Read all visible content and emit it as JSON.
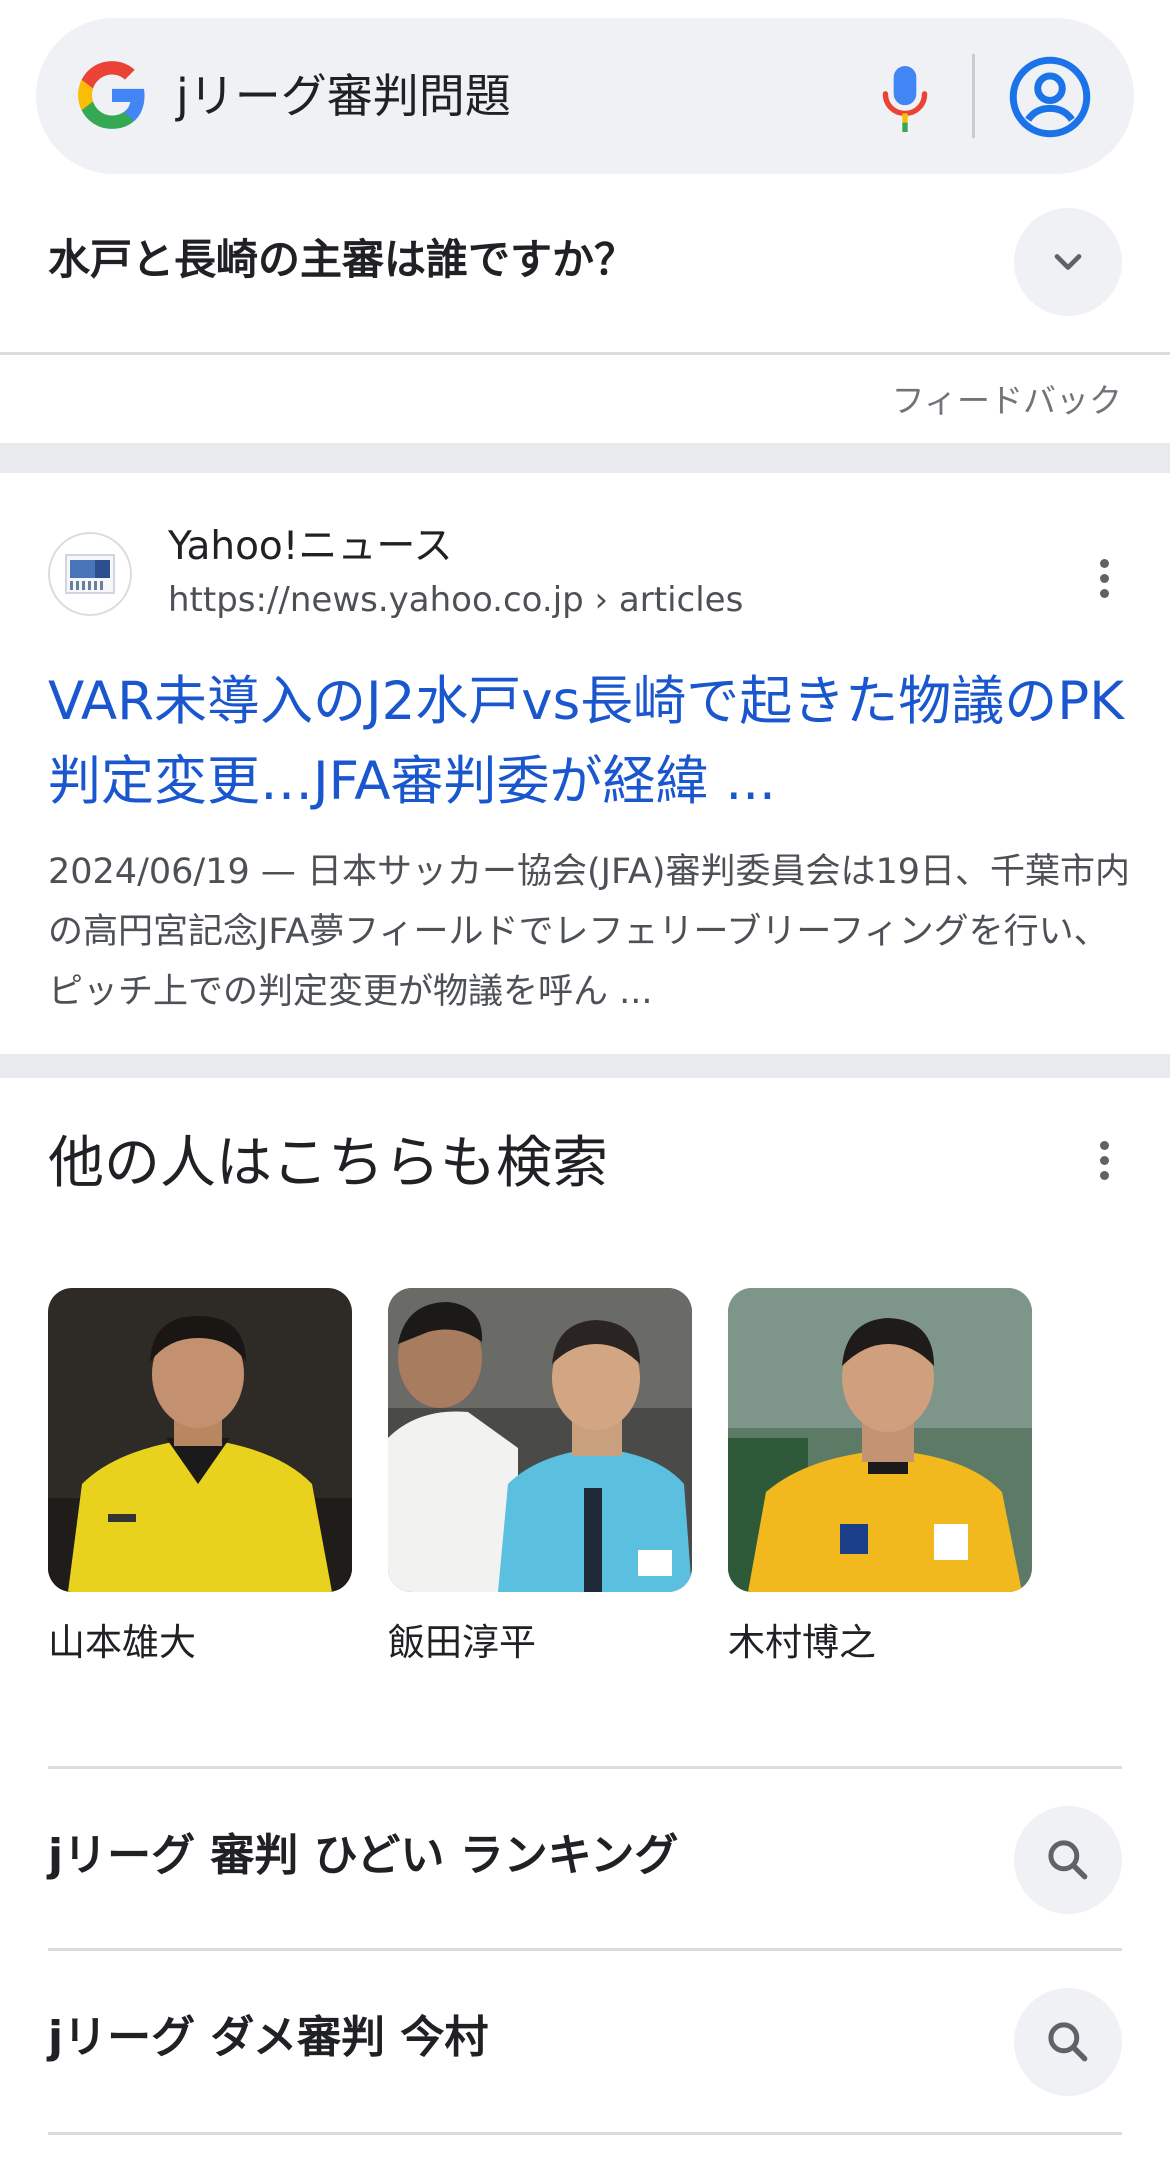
{
  "search": {
    "query": "jリーグ審判問題",
    "icons": {
      "logo": "google-g-logo",
      "mic": "mic-icon",
      "account": "account-circle-icon"
    }
  },
  "people_also_ask": {
    "question": "水戸と長崎の主審は誰ですか？",
    "expand_icon": "chevron-down-icon",
    "feedback_label": "フィードバック"
  },
  "result": {
    "site_name": "Yahoo!ニュース",
    "url": "https://news.yahoo.co.jp › articles",
    "title": "VAR未導入のJ2水戸vs長崎で起きた物議のPK判定変更…JFA審判委が経緯 ...",
    "snippet": "2024/06/19 — 日本サッカー協会(JFA)審判委員会は19日、千葉市内の高円宮記念JFA夢フィールドでレフェリーブリーフィングを行い、ピッチ上での判定変更が物議を呼ん ...",
    "menu_icon": "more-vert-icon"
  },
  "others_search": {
    "title": "他の人はこちらも検索",
    "menu_icon": "more-vert-icon",
    "cards": [
      {
        "name": "山本雄大"
      },
      {
        "name": "飯田淳平"
      },
      {
        "name": "木村博之"
      }
    ]
  },
  "related_searches": [
    {
      "label": "jリーグ 審判 ひどい ランキング"
    },
    {
      "label": "jリーグ ダメ審判 今村"
    }
  ],
  "colors": {
    "link_blue": "#1a57cf",
    "search_bg": "#eff1f4",
    "accent_blue": "#1a73e8",
    "referee_yellow": "#e8d21e",
    "referee_cyan": "#5bbfe0"
  }
}
